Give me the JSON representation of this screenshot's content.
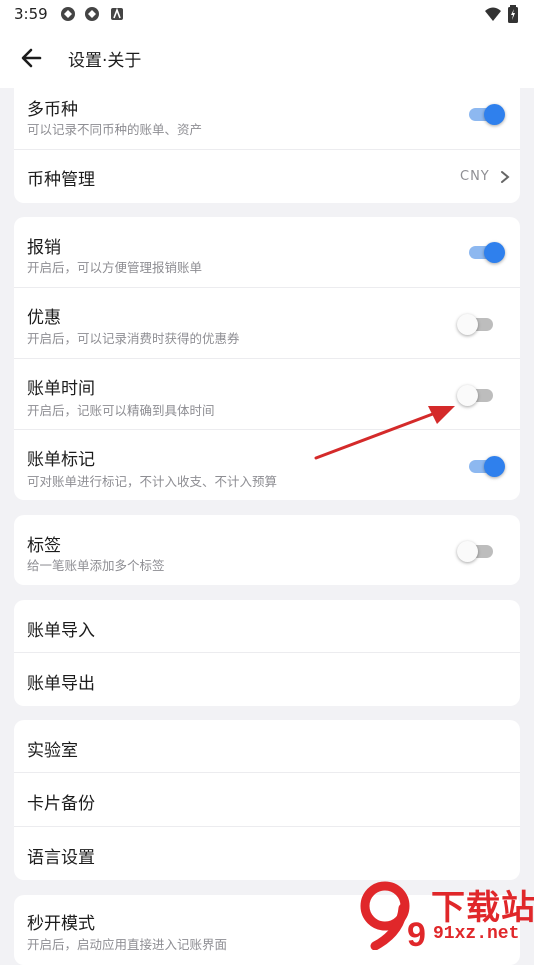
{
  "status_bar": {
    "time": "3:59"
  },
  "header": {
    "title": "设置·关于"
  },
  "sections": {
    "currency": {
      "multi": {
        "label": "多币种",
        "desc": "可以记录不同币种的账单、资产",
        "on": true
      },
      "manage": {
        "label": "币种管理",
        "value": "CNY"
      }
    },
    "options": {
      "reimburse": {
        "label": "报销",
        "desc": "开启后，可以方便管理报销账单",
        "on": true
      },
      "discount": {
        "label": "优惠",
        "desc": "开启后，可以记录消费时获得的优惠券",
        "on": false
      },
      "bill_time": {
        "label": "账单时间",
        "desc": "开启后，记账可以精确到具体时间",
        "on": false
      },
      "bill_mark": {
        "label": "账单标记",
        "desc": "可对账单进行标记，不计入收支、不计入预算",
        "on": true
      }
    },
    "tags": {
      "label": "标签",
      "desc": "给一笔账单添加多个标签",
      "on": false
    },
    "io": {
      "import": "账单导入",
      "export": "账单导出"
    },
    "misc": {
      "lab": "实验室",
      "backup": "卡片备份",
      "language": "语言设置"
    },
    "quick": {
      "label": "秒开模式",
      "desc": "开启后，启动应用直接进入记账界面"
    }
  },
  "watermark": {
    "text": "下载站",
    "domain": "91xz.net",
    "logo": "9"
  },
  "colors": {
    "accent": "#2f80ed",
    "arrow": "#d42a2a",
    "watermark": "#e0272a"
  }
}
